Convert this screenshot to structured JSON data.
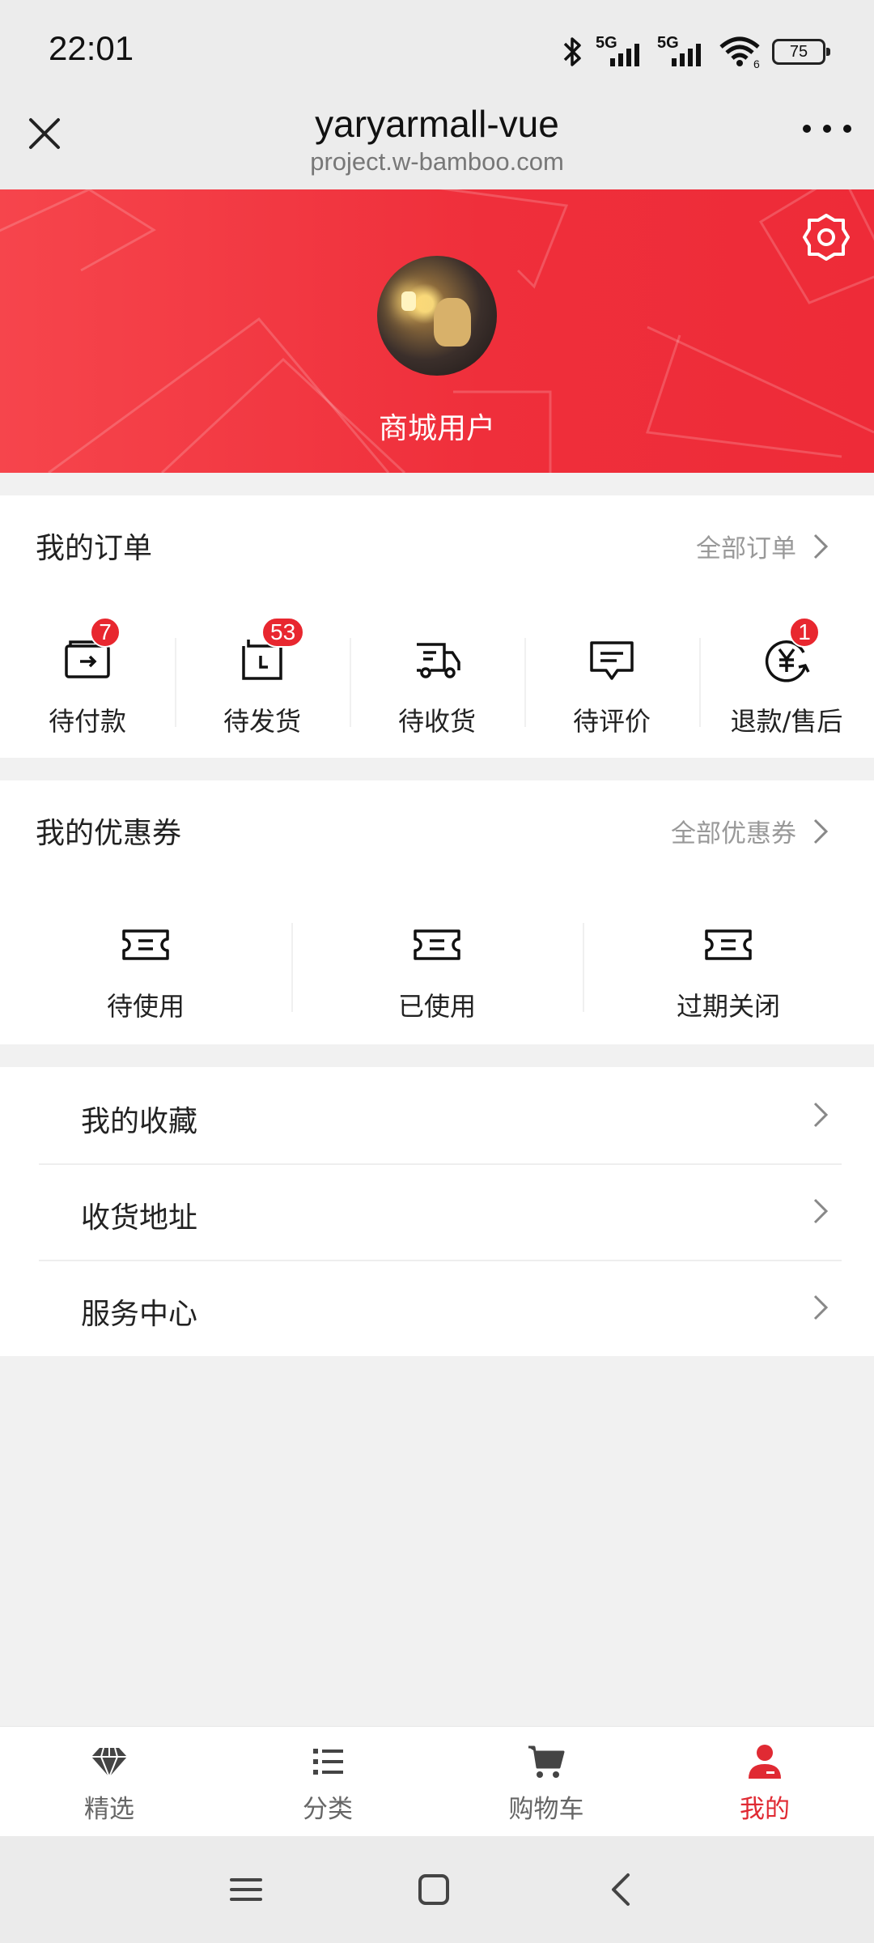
{
  "status_bar": {
    "time": "22:01",
    "network_label": "5G",
    "network_label_2": "5G",
    "wifi_badge": "6",
    "battery": "75"
  },
  "title_bar": {
    "title": "yaryarmall-vue",
    "subtitle": "project.w-bamboo.com"
  },
  "profile": {
    "username": "商城用户"
  },
  "orders": {
    "title": "我的订单",
    "link": "全部订单",
    "items": [
      {
        "label": "待付款",
        "icon": "wallet-arrow-icon",
        "badge": "7"
      },
      {
        "label": "待发货",
        "icon": "box-clock-icon",
        "badge": "53"
      },
      {
        "label": "待收货",
        "icon": "truck-icon",
        "badge": ""
      },
      {
        "label": "待评价",
        "icon": "comment-icon",
        "badge": ""
      },
      {
        "label": "退款/售后",
        "icon": "refund-yen-icon",
        "badge": "1"
      }
    ]
  },
  "coupons": {
    "title": "我的优惠券",
    "link": "全部优惠券",
    "items": [
      {
        "label": "待使用",
        "icon": "ticket-icon"
      },
      {
        "label": "已使用",
        "icon": "ticket-icon"
      },
      {
        "label": "过期关闭",
        "icon": "ticket-icon"
      }
    ]
  },
  "menu": {
    "items": [
      {
        "label": "我的收藏"
      },
      {
        "label": "收货地址"
      },
      {
        "label": "服务中心"
      }
    ]
  },
  "tabbar": {
    "items": [
      {
        "label": "精选",
        "icon": "diamond-icon"
      },
      {
        "label": "分类",
        "icon": "list-icon"
      },
      {
        "label": "购物车",
        "icon": "cart-icon"
      },
      {
        "label": "我的",
        "icon": "user-icon",
        "active": true
      }
    ]
  },
  "colors": {
    "accent": "#e02a33",
    "banner_start": "#f6454c",
    "banner_end": "#ee2b38",
    "badge": "#e8272f"
  }
}
